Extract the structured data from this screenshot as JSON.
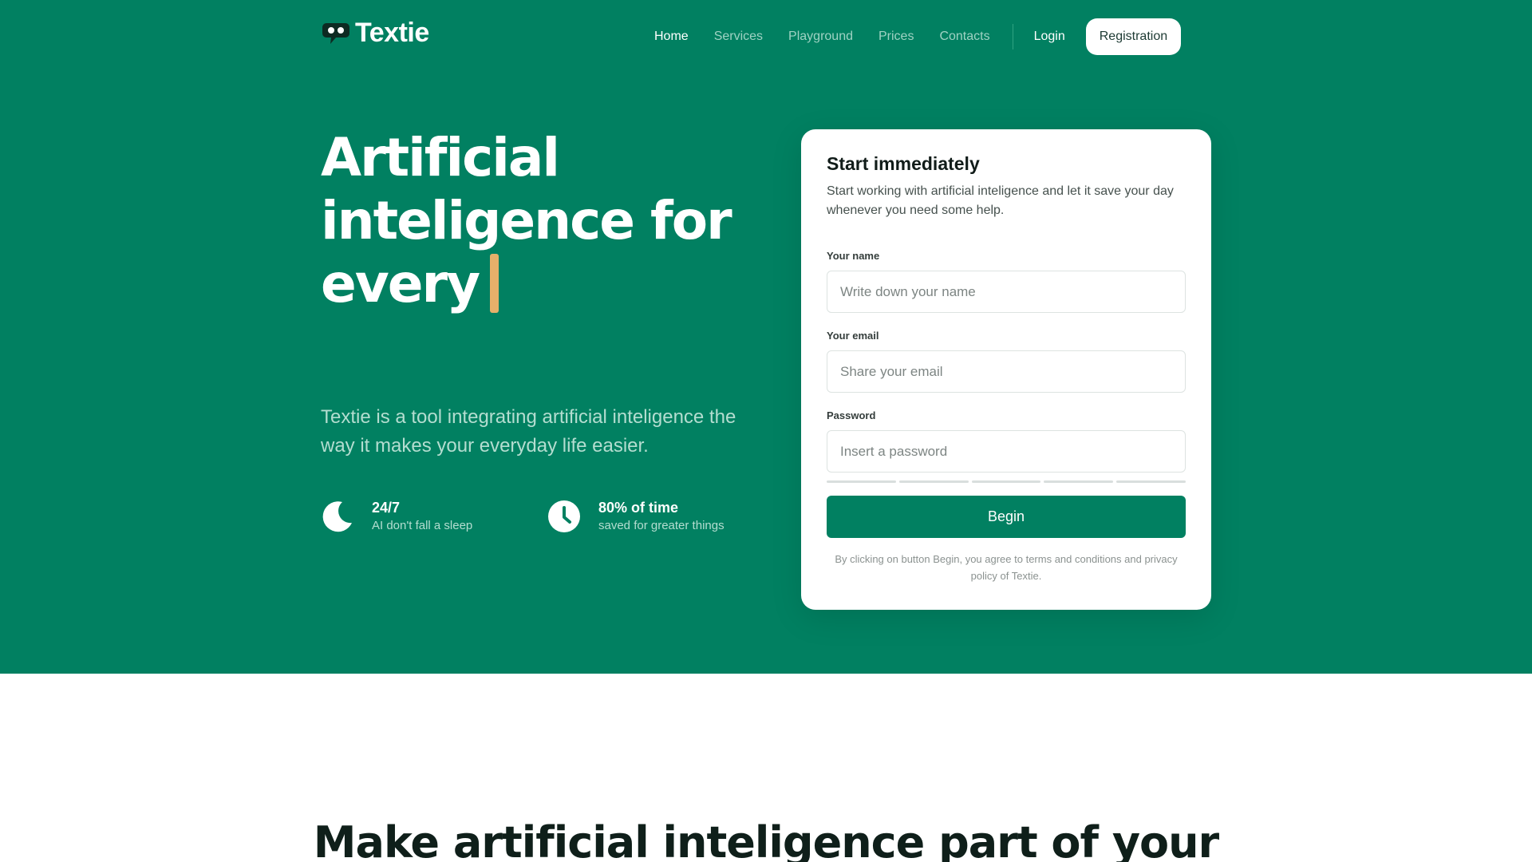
{
  "brand": {
    "name": "Textie"
  },
  "colors": {
    "primary": "#018061",
    "accent": "#e6b06a",
    "text_dark": "#0f1f1a"
  },
  "nav": {
    "items": [
      {
        "label": "Home",
        "active": true
      },
      {
        "label": "Services",
        "active": false
      },
      {
        "label": "Playground",
        "active": false
      },
      {
        "label": "Prices",
        "active": false
      },
      {
        "label": "Contacts",
        "active": false
      }
    ],
    "login_label": "Login",
    "register_label": "Registration"
  },
  "hero": {
    "headline": "Artificial inteligence for every",
    "subtitle": "Textie is a tool integrating artificial inteligence the way it makes your everyday life easier.",
    "features": [
      {
        "icon": "moon-icon",
        "title": "24/7",
        "subtitle": "AI don't fall a sleep"
      },
      {
        "icon": "clock-icon",
        "title": "80% of time",
        "subtitle": "saved for greater things"
      }
    ]
  },
  "signup_form": {
    "title": "Start immediately",
    "description": "Start working with artificial inteligence and let it save your day whenever you need some help.",
    "fields": [
      {
        "label": "Your name",
        "placeholder": "Write down your name",
        "value": ""
      },
      {
        "label": "Your email",
        "placeholder": "Share your email",
        "value": ""
      },
      {
        "label": "Password",
        "placeholder": "Insert a password",
        "value": ""
      }
    ],
    "password_strength": 0,
    "submit_label": "Begin",
    "terms": "By clicking on button Begin, you agree to terms and conditions and privacy policy of Textie."
  },
  "section": {
    "heading": "Make artificial inteligence part of your"
  }
}
